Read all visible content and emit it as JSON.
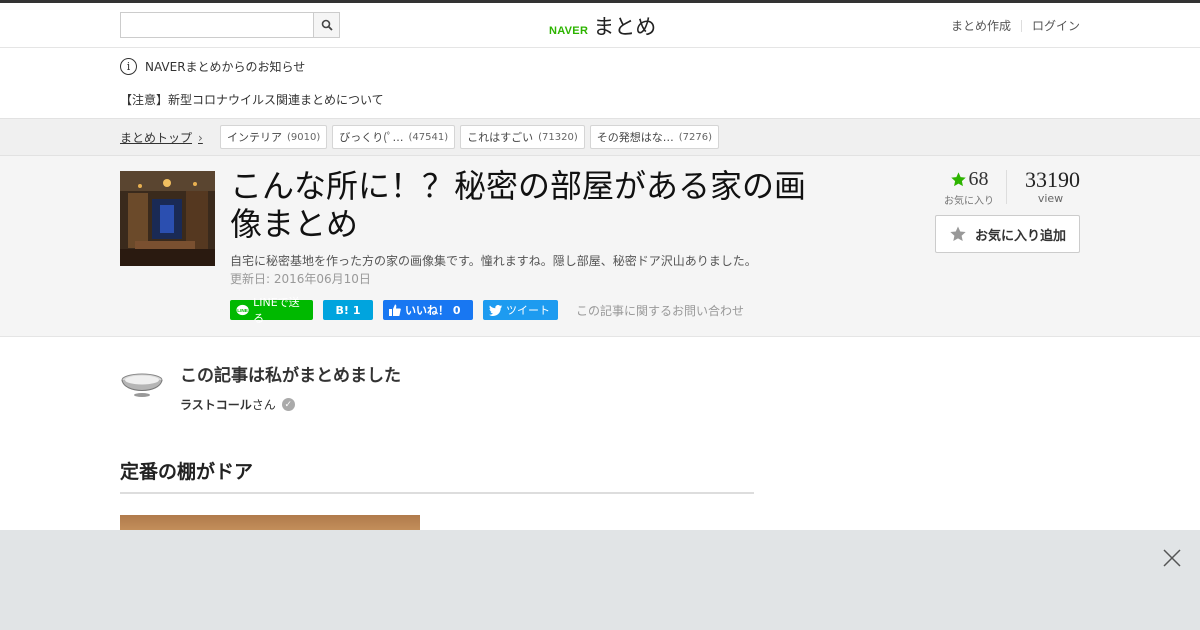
{
  "header": {
    "search": {
      "placeholder": "",
      "value": ""
    },
    "logo": {
      "brand": "NAVER",
      "service": "まとめ"
    },
    "links": {
      "create": "まとめ作成",
      "login": "ログイン"
    }
  },
  "notice": {
    "info": "NAVERまとめからのお知らせ",
    "item": "【注意】新型コロナウイルス関連まとめについて"
  },
  "breadcrumb": {
    "top": "まとめトップ",
    "tags": [
      {
        "label": "インテリア",
        "count": "(9010)"
      },
      {
        "label": "びっくり(ﾟ…",
        "count": "(47541)"
      },
      {
        "label": "これはすごい",
        "count": "(71320)"
      },
      {
        "label": "その発想はな…",
        "count": "(7276)"
      }
    ]
  },
  "article": {
    "title": "こんな所に！？秘密の部屋がある家の画像まとめ",
    "description": "自宅に秘密基地を作った方の家の画像集です。憧れますね。隠し部屋、秘密ドア沢山ありました。",
    "updated": "更新日: 2016年06月10日",
    "share": {
      "line": "LINEで送る",
      "hatena": "1",
      "hatena_icon": "B!",
      "facebook": "いいね！ 0",
      "twitter": "ツイート"
    },
    "inquiry": "この記事に関するお問い合わせ",
    "favorites": {
      "count": "68",
      "label": "お気に入り"
    },
    "views": {
      "count": "33190",
      "label": "view"
    },
    "fav_button": "お気に入り追加"
  },
  "author": {
    "heading": "この記事は私がまとめました",
    "name": "ラストコール",
    "suffix": "さん"
  },
  "section": {
    "heading": "定番の棚がドア"
  },
  "colors": {
    "naver_green": "#2db400",
    "line_green": "#00b900",
    "hatena_blue": "#00a4de",
    "facebook_blue": "#1877f2",
    "twitter_blue": "#1d9bf0"
  }
}
